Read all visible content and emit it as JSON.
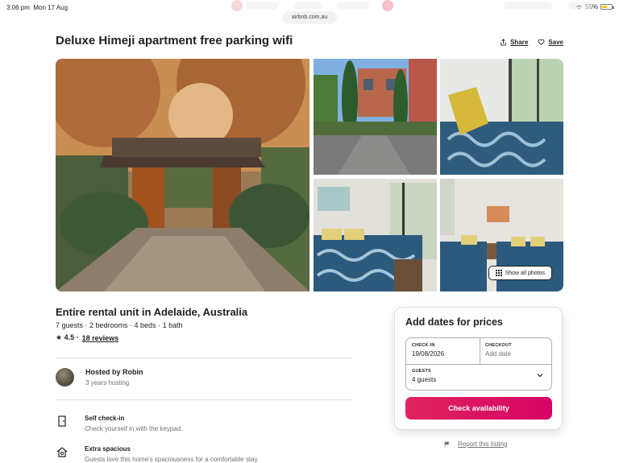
{
  "status_bar": {
    "time": "3:06 pm",
    "date": "Mon 17 Aug",
    "battery": "55%",
    "battery_level": 0.55,
    "icons": [
      "wifi-icon",
      "battery-icon"
    ]
  },
  "browser": {
    "url": "airbnb.com.au"
  },
  "listing": {
    "title": "Deluxe Himeji apartment free parking wifi",
    "share_label": "Share",
    "save_label": "Save",
    "show_all_photos": "Show all photos",
    "photos": [
      "garden-gate-photo",
      "apartment-exterior-photo",
      "bedroom-window-photo",
      "bedroom-queen-photo",
      "bedroom-twin-photo"
    ],
    "subtitle": "Entire rental unit in Adelaide, Australia",
    "details": "7 guests · 2 bedrooms · 4 beds · 1 bath",
    "rating": "★ 4.5 ·",
    "reviews": "18 reviews"
  },
  "host": {
    "name": "Hosted by Robin",
    "tenure": "3 years hosting"
  },
  "features": [
    {
      "icon": "door-icon",
      "title": "Self check-in",
      "subtitle": "Check yourself in with the keypad."
    },
    {
      "icon": "home-icon",
      "title": "Extra spacious",
      "subtitle": "Guests love this home's spaciousness for a comfortable stay."
    }
  ],
  "booking": {
    "title": "Add dates for prices",
    "checkin_label": "CHECK-IN",
    "checkin_value": "19/08/2026",
    "checkout_label": "CHECKOUT",
    "checkout_placeholder": "Add date",
    "guests_label": "GUESTS",
    "guests_value": "4 guests",
    "button": "Check availability",
    "accent": "#e0245e"
  },
  "report": {
    "label": "Report this listing"
  }
}
